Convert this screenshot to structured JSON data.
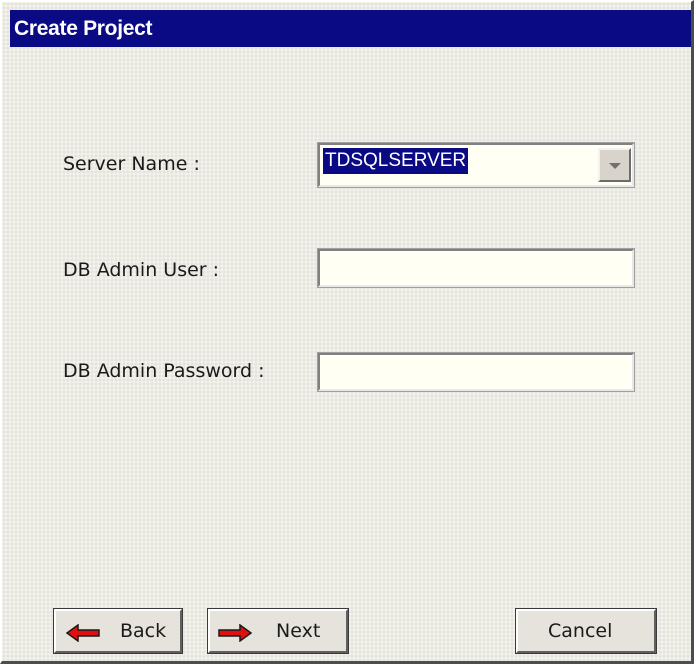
{
  "window": {
    "title": "Create Project"
  },
  "form": {
    "server_name": {
      "label": "Server Name :",
      "value": "TDSQLSERVER"
    },
    "db_admin_user": {
      "label": "DB Admin User :",
      "value": ""
    },
    "db_admin_password": {
      "label": "DB Admin Password :",
      "value": ""
    }
  },
  "buttons": {
    "back": "Back",
    "next": "Next",
    "cancel": "Cancel"
  },
  "icons": {
    "back": "arrow-left-icon",
    "next": "arrow-right-icon",
    "dropdown": "chevron-down-icon"
  },
  "colors": {
    "titlebar": "#0a0a84",
    "arrow_fill": "#e01010"
  }
}
